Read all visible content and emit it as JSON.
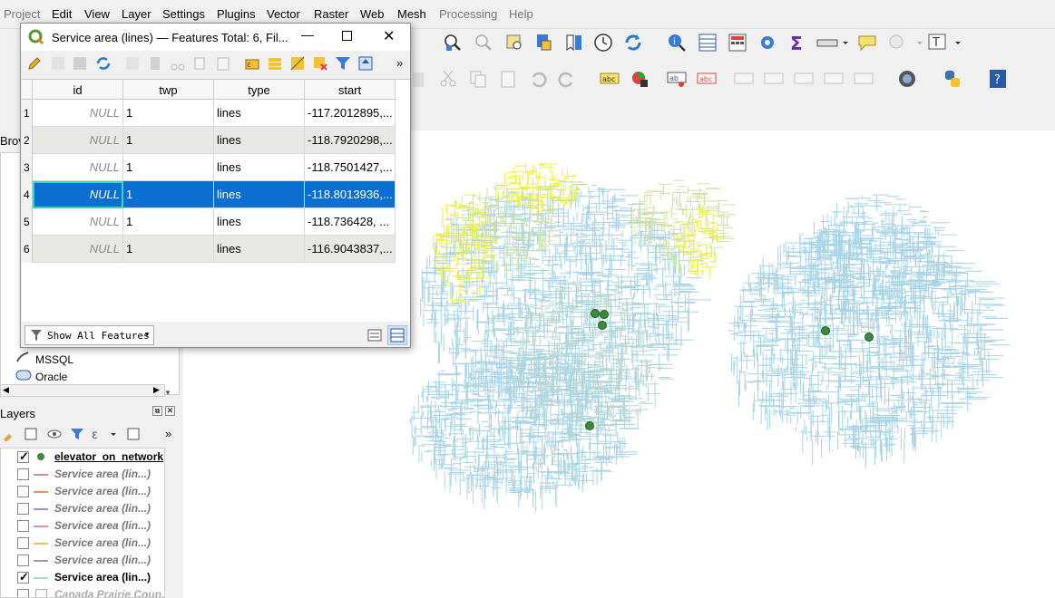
{
  "menu": [
    "Project",
    "Edit",
    "View",
    "Layer",
    "Settings",
    "Plugins",
    "Vector",
    "Raster",
    "Web",
    "Mesh",
    "Processing",
    "Help"
  ],
  "dialog": {
    "title": "Service area (lines) — Features Total: 6, Fil...",
    "columns": [
      "id",
      "twp",
      "type",
      "start"
    ],
    "rows": [
      {
        "num": "1",
        "id": "NULL",
        "twp": "1",
        "type": "lines",
        "start": "-117.2012895,..."
      },
      {
        "num": "2",
        "id": "NULL",
        "twp": "1",
        "type": "lines",
        "start": "-118.7920298,..."
      },
      {
        "num": "3",
        "id": "NULL",
        "twp": "1",
        "type": "lines",
        "start": "-118.7501427,..."
      },
      {
        "num": "4",
        "id": "NULL",
        "twp": "1",
        "type": "lines",
        "start": "-118.8013936,..."
      },
      {
        "num": "5",
        "id": "NULL",
        "twp": "1",
        "type": "lines",
        "start": "-118.736428, ..."
      },
      {
        "num": "6",
        "id": "NULL",
        "twp": "1",
        "type": "lines",
        "start": "-116.9043837,..."
      }
    ],
    "selected_row": 4,
    "show_all_label": "Show All Features",
    "more": "»"
  },
  "browser": {
    "title_fragment": "Brov",
    "items": [
      "MSSQL",
      "Oracle"
    ]
  },
  "layers": {
    "title": "Layers",
    "more": "»",
    "items": [
      {
        "name": "elevator_on_network",
        "checked": true,
        "color": "#3d8a3d"
      },
      {
        "name": "Service area (lin...)",
        "checked": false,
        "color": "#e08a8a"
      },
      {
        "name": "Service area (lin...)",
        "checked": false,
        "color": "#e0956a"
      },
      {
        "name": "Service area (lin...)",
        "checked": false,
        "color": "#b08ac8"
      },
      {
        "name": "Service area (lin...)",
        "checked": false,
        "color": "#e08ac0"
      },
      {
        "name": "Service area (lin...)",
        "checked": false,
        "color": "#e8c060"
      },
      {
        "name": "Service area (lin...)",
        "checked": false,
        "color": "#a0a0a0"
      },
      {
        "name": "Service area (lin...)",
        "checked": true,
        "color": "#a8d4e6"
      },
      {
        "name": "Canada Prairie Coun...",
        "checked": false,
        "color": "#d8d8d8"
      }
    ]
  },
  "colors": {
    "selection": "#0a6fd1",
    "network": "#a8d4e6",
    "highlight": "#f2f230",
    "points": "#3d8a3d"
  }
}
